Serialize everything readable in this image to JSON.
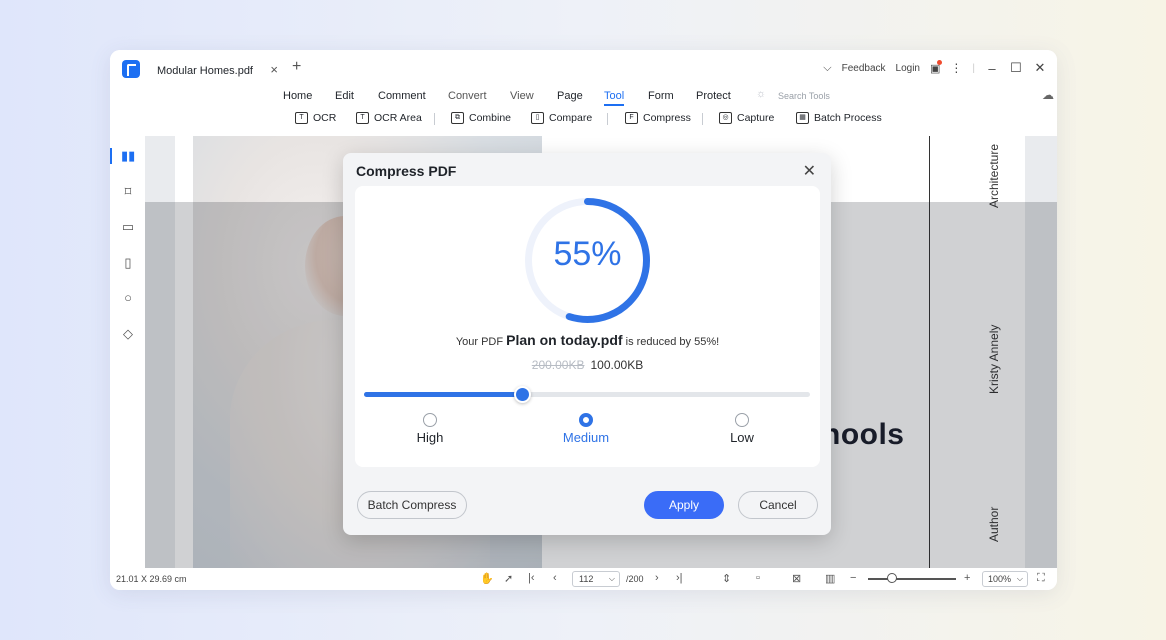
{
  "titlebar": {
    "tab_label": "Modular Homes.pdf",
    "tab_close": "×",
    "tab_add": "+",
    "feedback": "Feedback",
    "login": "Login"
  },
  "menu": {
    "items": [
      {
        "label": "Home",
        "active": false
      },
      {
        "label": "Edit",
        "active": false
      },
      {
        "label": "Comment",
        "active": false
      },
      {
        "label": "Convert",
        "active": false
      },
      {
        "label": "View",
        "active": false
      },
      {
        "label": "Page",
        "active": false
      },
      {
        "label": "Tool",
        "active": true
      },
      {
        "label": "Form",
        "active": false
      },
      {
        "label": "Protect",
        "active": false
      }
    ],
    "search_placeholder": "Search Tools"
  },
  "toolbar": {
    "items": [
      {
        "label": "OCR",
        "icon": "ocr-icon",
        "glyph": "T"
      },
      {
        "label": "OCR Area",
        "icon": "ocr-area-icon",
        "glyph": "T"
      },
      {
        "label": "Combine",
        "icon": "combine-icon",
        "glyph": "⧉"
      },
      {
        "label": "Compare",
        "icon": "compare-icon",
        "glyph": "▯"
      },
      {
        "label": "Compress",
        "icon": "compress-icon",
        "glyph": "F"
      },
      {
        "label": "Capture",
        "icon": "capture-icon",
        "glyph": "◎"
      },
      {
        "label": "Batch Process",
        "icon": "batch-process-icon",
        "glyph": "▦"
      }
    ]
  },
  "document": {
    "vertical_text_top": "Architecture",
    "vertical_text_mid": "Kristy Annely",
    "vertical_text_bottom": "Author",
    "partial_heading": "hools"
  },
  "statusbar": {
    "dimensions": "21.01 X 29.69 cm",
    "current_page": "112",
    "total_pages": "/200",
    "zoom": "100%",
    "zoom_level": 0.22
  },
  "dialog": {
    "title": "Compress PDF",
    "percent_text": "55%",
    "percent_value": 55,
    "result_prefix": "Your PDF ",
    "file_name": "Plan on today.pdf",
    "result_suffix": " is reduced by 55%!",
    "old_size": "200.00KB",
    "new_size": "100.00KB",
    "slider_value": 0.355,
    "options": [
      {
        "label": "High",
        "selected": false
      },
      {
        "label": "Medium",
        "selected": true
      },
      {
        "label": "Low",
        "selected": false
      }
    ],
    "batch_button": "Batch Compress",
    "apply_button": "Apply",
    "cancel_button": "Cancel",
    "accent_color": "#2f73e6",
    "apply_color": "#3a6cf7"
  }
}
